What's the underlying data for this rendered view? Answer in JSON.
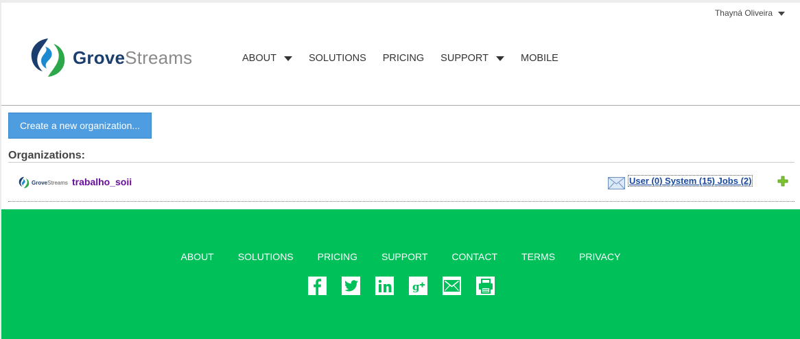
{
  "header": {
    "user_name": "Thayná Oliveira",
    "logo": {
      "part1": "Grove",
      "part2": "Streams"
    },
    "nav": [
      {
        "label": "ABOUT",
        "has_dropdown": true
      },
      {
        "label": "SOLUTIONS",
        "has_dropdown": false
      },
      {
        "label": "PRICING",
        "has_dropdown": false
      },
      {
        "label": "SUPPORT",
        "has_dropdown": true
      },
      {
        "label": "MOBILE",
        "has_dropdown": false
      }
    ]
  },
  "main": {
    "create_button": "Create a new organization...",
    "orgs_heading": "Organizations:",
    "organizations": [
      {
        "logo_text": {
          "part1": "Grove",
          "part2": "Streams"
        },
        "name": "trabalho_soii",
        "counts": "User (0) System (15) Jobs (2)"
      }
    ]
  },
  "footer": {
    "links": [
      "ABOUT",
      "SOLUTIONS",
      "PRICING",
      "SUPPORT",
      "CONTACT",
      "TERMS",
      "PRIVACY"
    ],
    "social": [
      "facebook-icon",
      "twitter-icon",
      "linkedin-icon",
      "google-plus-icon",
      "email-icon",
      "print-icon"
    ]
  },
  "colors": {
    "footer_bg": "#00c05a",
    "button_bg": "#4d9de0",
    "org_name": "#6a0d9c",
    "link": "#1a4a9e",
    "logo_navy": "#1b3e6e",
    "logo_green": "#2ca84a"
  }
}
